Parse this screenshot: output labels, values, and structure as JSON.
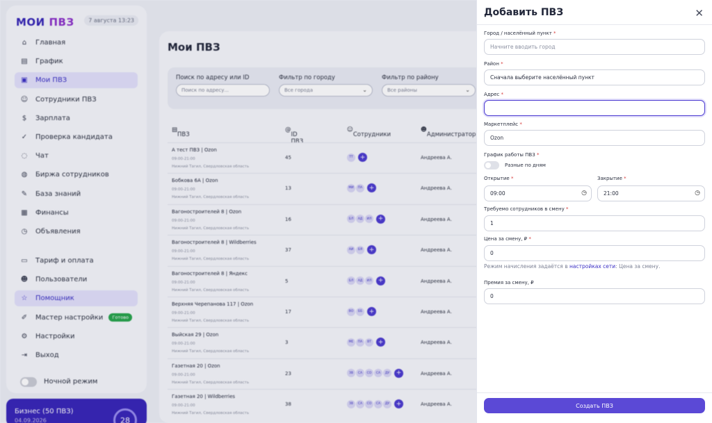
{
  "sidebar": {
    "logo_main": "МОИ ",
    "logo_accent": "ПВЗ",
    "date": "7 августа 13:23",
    "items": [
      {
        "icon": "⌂",
        "label": "Главная"
      },
      {
        "icon": "▤",
        "label": "График"
      },
      {
        "icon": "▣",
        "label": "Мои ПВЗ",
        "active": true
      },
      {
        "icon": "☺",
        "label": "Сотрудники ПВЗ"
      },
      {
        "icon": "$",
        "label": "Зарплата"
      },
      {
        "icon": "✓",
        "label": "Проверка кандидата"
      },
      {
        "icon": "◌",
        "label": "Чат"
      },
      {
        "icon": "◍",
        "label": "Биржа сотрудников"
      },
      {
        "icon": "✎",
        "label": "База знаний"
      },
      {
        "icon": "▦",
        "label": "Финансы"
      },
      {
        "icon": "◷",
        "label": "Объявления"
      }
    ],
    "items2": [
      {
        "icon": "▭",
        "label": "Тариф и оплата"
      },
      {
        "icon": "☻",
        "label": "Пользователи"
      },
      {
        "icon": "☆",
        "label": "Помощник",
        "active": true
      },
      {
        "icon": "✐",
        "label": "Мастер настройки",
        "tag": "Готово"
      },
      {
        "icon": "⚙",
        "label": "Настройки"
      },
      {
        "icon": "⇥",
        "label": "Выход"
      }
    ],
    "night_mode": "Ночной режим",
    "plan_name": "Бизнес (50 ПВЗ)",
    "plan_date": "04.09.2026",
    "plan_days": "28"
  },
  "main": {
    "title": "Мои ПВЗ",
    "filters": {
      "search_label": "Поиск по адресу или ID",
      "search_placeholder": "Поиск по адресу...",
      "city_label": "Фильтр по городу",
      "city_value": "Все города",
      "district_label": "Фильтр по району",
      "district_value": "Все районы"
    },
    "columns": {
      "pvz": "ПВЗ",
      "id": "ID ПВЗ",
      "staff": "Сотрудники",
      "admin": "Администратор"
    },
    "rows": [
      {
        "name": "А тест ПВЗ | Ozon",
        "time": "09:00-21:00",
        "loc": "Нижний Тагил, Свердловская область",
        "id": "45",
        "staff": [
          "ТТ"
        ],
        "admin": "Андреева А."
      },
      {
        "name": "Бобкова 6А | Ozon",
        "time": "09:00-21:00",
        "loc": "Нижний Тагил, Свердловская область",
        "id": "13",
        "staff": [
          "МИ",
          "ПА"
        ],
        "admin": "Андреева А."
      },
      {
        "name": "Вагоностроителей 8 | Ozon",
        "time": "09:00-21:00",
        "loc": "Нижний Тагил, Свердловская область",
        "id": "16",
        "staff": [
          "БЛ",
          "АД",
          "ИЛ"
        ],
        "admin": "Андреева А."
      },
      {
        "name": "Вагоностроителей 8 | Wildberries",
        "time": "09:00-21:00",
        "loc": "Нижний Тагил, Свердловская область",
        "id": "37",
        "staff": [
          "АИ",
          "БЯ"
        ],
        "admin": "Андреева А."
      },
      {
        "name": "Вагоностроителей 8 | Яндекс",
        "time": "09:00-21:00",
        "loc": "Нижний Тагил, Свердловская область",
        "id": "5",
        "staff": [
          "БЛ",
          "АД",
          "ИЛ"
        ],
        "admin": "Андреева А."
      },
      {
        "name": "Верхняя Черепанова 117 | Ozon",
        "time": "09:00-21:00",
        "loc": "Нижний Тагил, Свердловская область",
        "id": "17",
        "staff": [
          "ВО",
          "ББ"
        ],
        "admin": "Андреева А."
      },
      {
        "name": "Выйская 29 | Ozon",
        "time": "09:00-21:00",
        "loc": "Нижний Тагил, Свердловская область",
        "id": "3",
        "staff": [
          "МЕ",
          "ПА",
          "ВТ"
        ],
        "admin": "Андреева А."
      },
      {
        "name": "Газетная 20 | Ozon",
        "time": "09:00-21:00",
        "loc": "Нижний Тагил, Свердловская область",
        "id": "23",
        "staff": [
          "ЗВ",
          "СА",
          "СО",
          "СА",
          "ДУ"
        ],
        "admin": "Андреева А."
      },
      {
        "name": "Газетная 20 | Wildberries",
        "time": "09:00-21:00",
        "loc": "Нижний Тагил, Свердловская область",
        "id": "38",
        "staff": [
          "ЗВ",
          "СА",
          "СО",
          "СА",
          "ДУ"
        ],
        "admin": "Андреева А."
      }
    ]
  },
  "panel": {
    "title": "Добавить ПВЗ",
    "city_label": "Город / населённый пункт",
    "city_placeholder": "Начните вводить город",
    "district_label": "Район",
    "district_placeholder": "Сначала выберите населённый пункт",
    "address_label": "Адрес",
    "address_value": "",
    "marketplace_label": "Маркетплейс",
    "marketplace_value": "Ozon",
    "schedule_label": "График работы ПВЗ",
    "schedule_toggle": "Разные по дням",
    "open_label": "Открытие",
    "open_value": "09:00",
    "close_label": "Закрытие",
    "close_value": "21:00",
    "staff_label": "Требуемо сотрудников в смену",
    "staff_value": "1",
    "price_label": "Цена за смену, ₽",
    "price_value": "0",
    "hint_before": "Режим начисления задаётся в ",
    "hint_link": "настройках сети",
    "hint_after": ": Цена за смену.",
    "bonus_label": "Премия за смену, ₽",
    "bonus_value": "0",
    "submit": "Создать ПВЗ",
    "required_mark": "*"
  }
}
